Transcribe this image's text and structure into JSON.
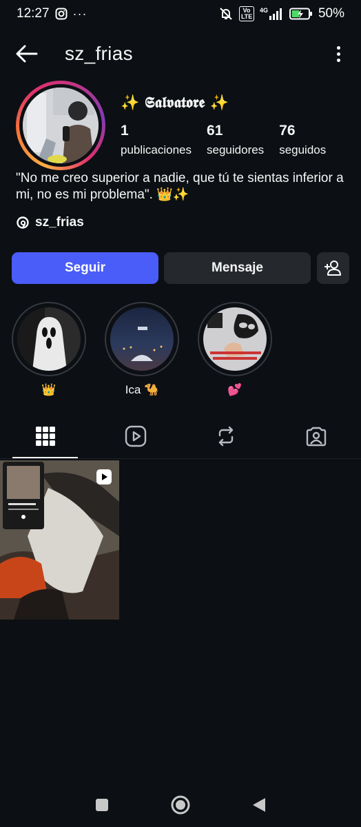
{
  "status_bar": {
    "time": "12:27",
    "more": "···",
    "network": "4G",
    "volte": "Vo LTE",
    "battery": "50%"
  },
  "header": {
    "username": "sz_frias",
    "back_icon": "arrow-left-icon",
    "more_icon": "more-vertical-icon"
  },
  "profile": {
    "display_name": "✨ 𝕾𝖆𝖑𝖛𝖆𝖙𝖔𝖗𝖊 ✨",
    "stats": [
      {
        "value": "1",
        "label": "publicaciones"
      },
      {
        "value": "61",
        "label": "seguidores"
      },
      {
        "value": "76",
        "label": "seguidos"
      }
    ],
    "bio": "\"No me creo superior a nadie, que tú te sientas inferior a mi, no es mi problema\". 👑✨",
    "threads_handle": "sz_frias"
  },
  "actions": {
    "follow_label": "Seguir",
    "message_label": "Mensaje",
    "add_user_icon": "person-add-icon"
  },
  "highlights": [
    {
      "label": "👑"
    },
    {
      "label": "Ica 🐪"
    },
    {
      "label": "💕"
    }
  ],
  "tabs": [
    {
      "icon": "grid-icon",
      "active": true
    },
    {
      "icon": "reels-icon",
      "active": false
    },
    {
      "icon": "reposts-icon",
      "active": false
    },
    {
      "icon": "tagged-icon",
      "active": false
    }
  ],
  "colors": {
    "background": "#0c1014",
    "follow_button": "#4a5df9",
    "secondary_button": "#25292e"
  }
}
